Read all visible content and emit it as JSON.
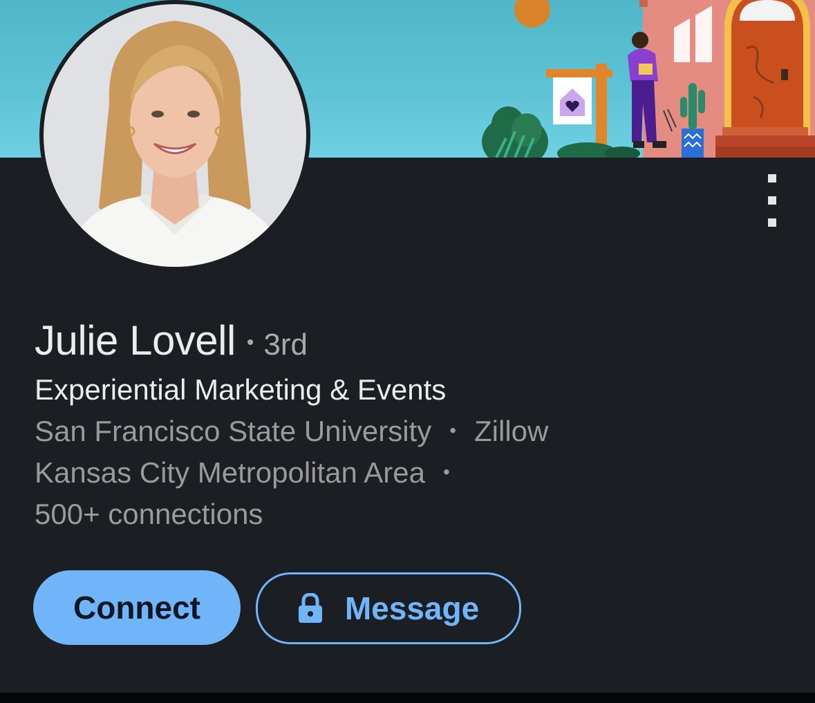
{
  "profile": {
    "name": "Julie Lovell",
    "degree_separator": "•",
    "degree": "3rd",
    "headline": "Experiential Marketing & Events",
    "education": "San Francisco State University",
    "company": "Zillow",
    "location": "Kansas City Metropolitan Area",
    "connections": "500+ connections",
    "separator": "•"
  },
  "actions": {
    "connect_label": "Connect",
    "message_label": "Message"
  },
  "icons": {
    "more": "more-vertical-icon",
    "lock": "lock-icon"
  },
  "colors": {
    "background": "#1b1f23",
    "accent": "#70b5f9",
    "text_primary": "#ececec",
    "text_muted": "#9a9a9a"
  }
}
